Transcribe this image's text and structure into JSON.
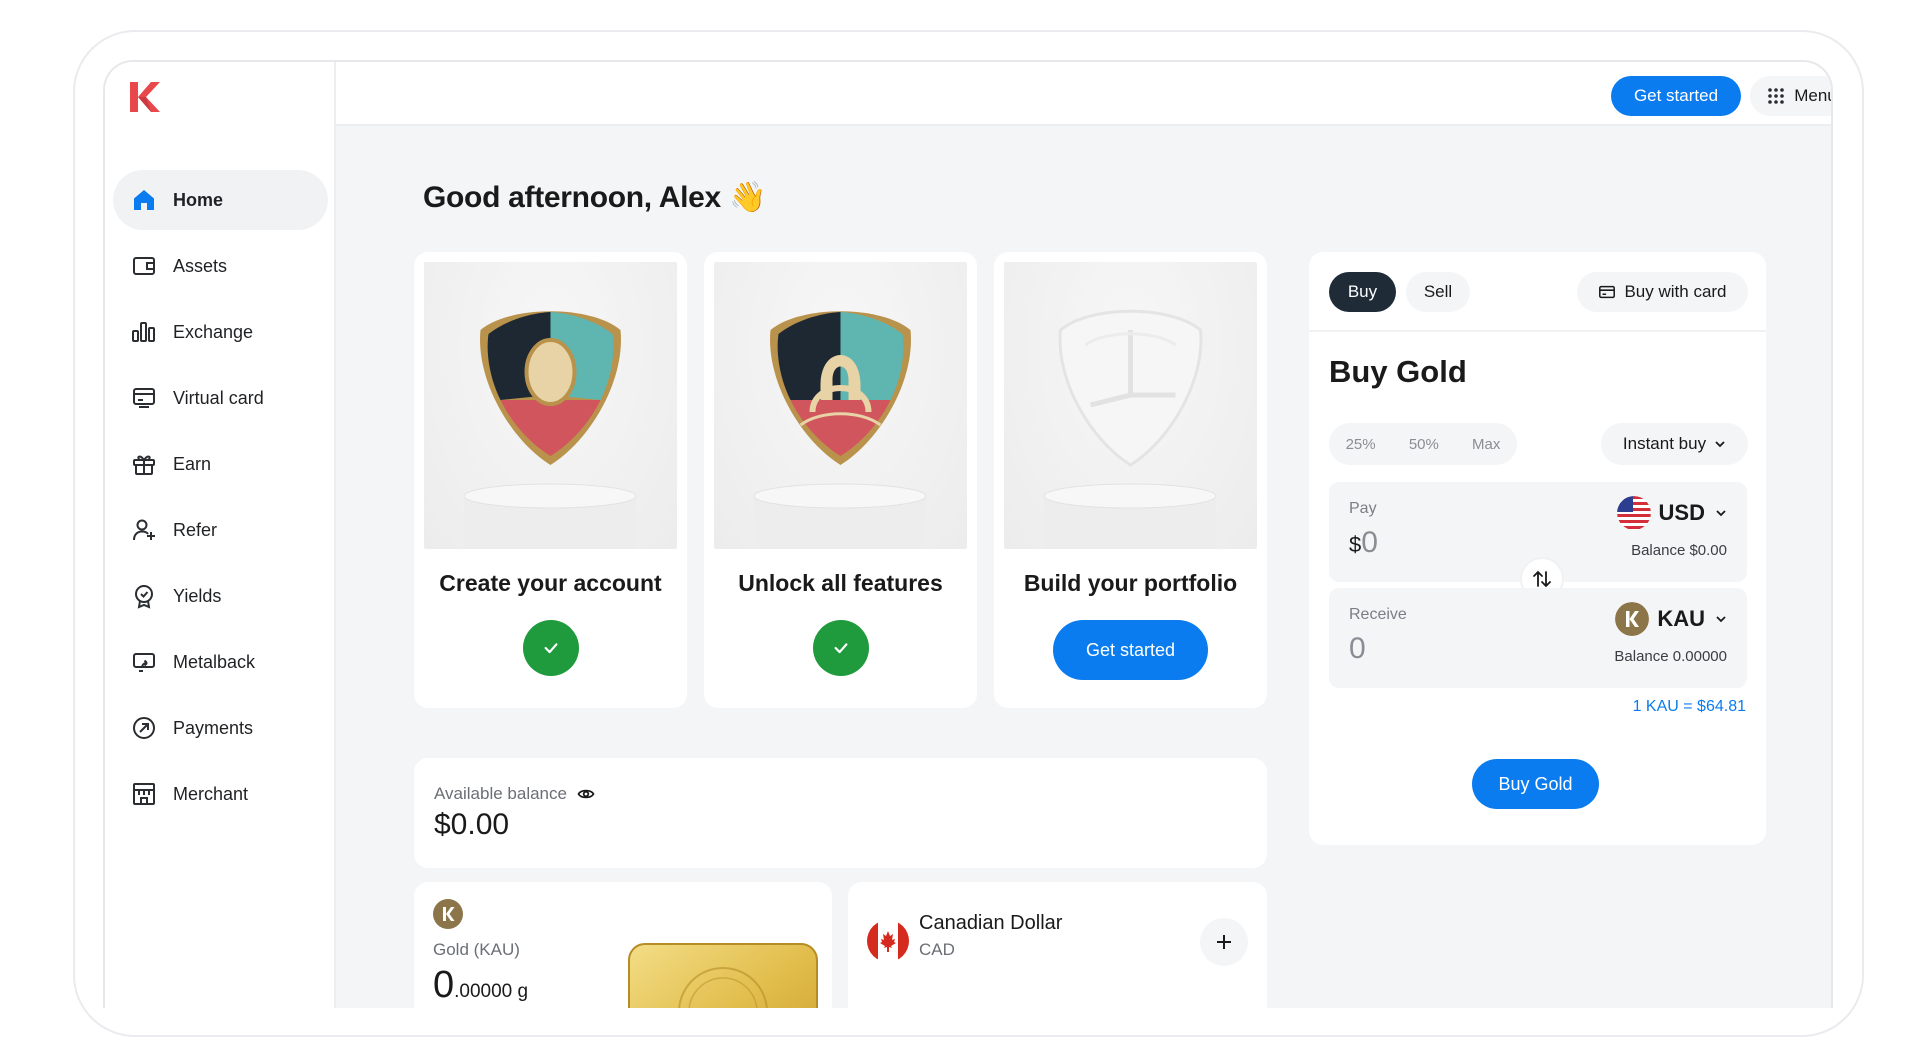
{
  "topbar": {
    "get_started_label": "Get started",
    "menu_label": "Menu"
  },
  "sidebar": {
    "items": [
      {
        "label": "Home",
        "icon": "home-icon",
        "active": true
      },
      {
        "label": "Assets",
        "icon": "wallet-icon"
      },
      {
        "label": "Exchange",
        "icon": "exchange-icon"
      },
      {
        "label": "Virtual card",
        "icon": "card-icon"
      },
      {
        "label": "Earn",
        "icon": "gift-icon"
      },
      {
        "label": "Refer",
        "icon": "user-plus-icon"
      },
      {
        "label": "Yields",
        "icon": "yield-icon"
      },
      {
        "label": "Metalback",
        "icon": "metalback-icon"
      },
      {
        "label": "Payments",
        "icon": "payments-icon"
      },
      {
        "label": "Merchant",
        "icon": "merchant-icon"
      }
    ]
  },
  "main": {
    "greeting": "Good afternoon, Alex",
    "greeting_emoji": "👋",
    "steps": [
      {
        "title": "Create your account",
        "status": "complete"
      },
      {
        "title": "Unlock all features",
        "status": "complete"
      },
      {
        "title": "Build your portfolio",
        "status": "pending",
        "button_label": "Get started"
      }
    ],
    "balance": {
      "label": "Available balance",
      "value": "$0.00"
    },
    "gold": {
      "name": "Gold (KAU)",
      "amount_int": "0",
      "amount_dec": ".00000 g"
    },
    "cad": {
      "name": "Canadian Dollar",
      "code": "CAD"
    }
  },
  "trade": {
    "tabs": [
      "Buy",
      "Sell"
    ],
    "active_tab": "Buy",
    "buy_with_card_label": "Buy with card",
    "title": "Buy Gold",
    "percent_options": [
      "25%",
      "50%",
      "Max"
    ],
    "mode_label": "Instant buy",
    "pay": {
      "label": "Pay",
      "symbol": "$",
      "amount": "0",
      "currency": "USD",
      "balance": "Balance $0.00"
    },
    "receive": {
      "label": "Receive",
      "amount": "0",
      "currency": "KAU",
      "balance": "Balance 0.00000"
    },
    "rate": "1 KAU = $64.81",
    "submit_label": "Buy Gold"
  },
  "colors": {
    "accent": "#0a7cf0",
    "success": "#1f9a3c",
    "brand": "#e8474c"
  }
}
